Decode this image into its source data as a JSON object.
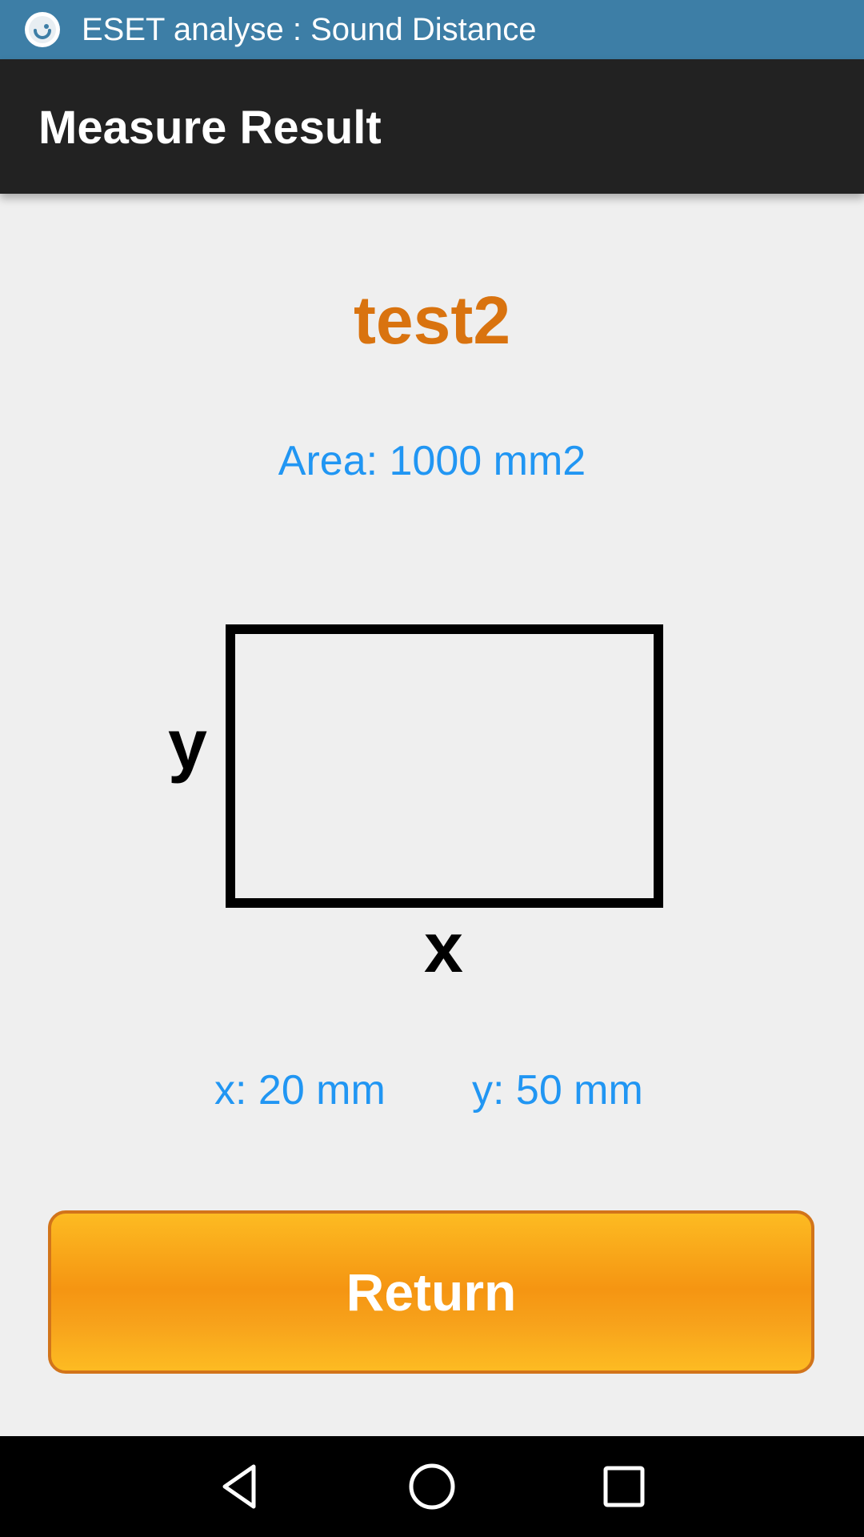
{
  "status_bar": {
    "app_icon": "eset-app-icon",
    "title": "ESET analyse : Sound Distance",
    "background": "#3d7ea6"
  },
  "app_bar": {
    "title": "Measure Result",
    "background": "#222222"
  },
  "result": {
    "name": "test2",
    "area_text": "Area: 1000 mm2",
    "x_text": "x: 20 mm",
    "y_text": "y: 50 mm",
    "name_color": "#d9730f",
    "value_color": "#2196f3"
  },
  "diagram": {
    "shape": "rectangle",
    "label_x": "x",
    "label_y": "y"
  },
  "actions": {
    "return_label": "Return",
    "button_color": "#f59512"
  },
  "nav_bar": {
    "back_icon": "back-triangle-icon",
    "home_icon": "home-circle-icon",
    "recents_icon": "recents-square-icon"
  }
}
